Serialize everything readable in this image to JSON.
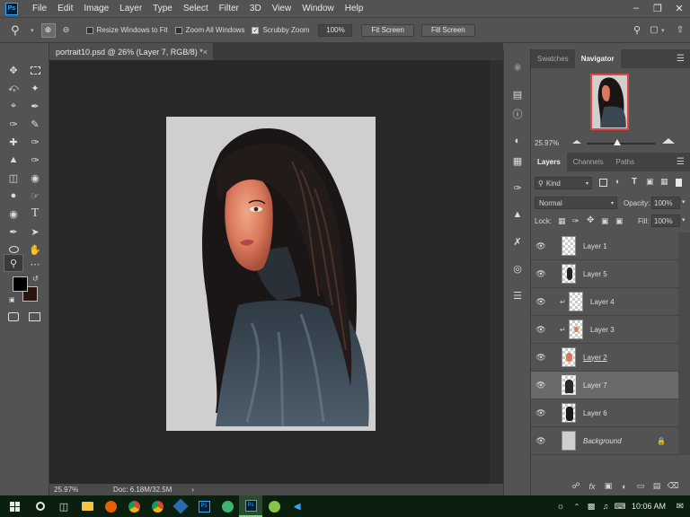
{
  "menubar": {
    "logo": "Ps",
    "items": [
      "File",
      "Edit",
      "Image",
      "Layer",
      "Type",
      "Select",
      "Filter",
      "3D",
      "View",
      "Window",
      "Help"
    ],
    "window_controls": [
      "–",
      "❐",
      "✕"
    ]
  },
  "options_bar": {
    "resize_windows": {
      "label": "Resize Windows to Fit",
      "checked": false
    },
    "zoom_all": {
      "label": "Zoom All Windows",
      "checked": false
    },
    "scrubby": {
      "label": "Scrubby Zoom",
      "checked": true
    },
    "zoom_value": "100%",
    "fit_screen": "Fit Screen",
    "fill_screen": "Fill Screen"
  },
  "document": {
    "tab_title": "portrait10.psd @ 26% (Layer 7, RGB/8) *",
    "close": "×"
  },
  "status": {
    "zoom": "25.97%",
    "doc": "Doc: 6.18M/32.5M",
    "arrow": "›"
  },
  "navigator": {
    "tabs": [
      "Swatches",
      "Navigator"
    ],
    "active_tab": "Navigator",
    "zoom": "25.97%",
    "slider_fraction": 0.45
  },
  "layers_panel": {
    "tabs": [
      "Layers",
      "Channels",
      "Paths"
    ],
    "active_tab": "Layers",
    "filter": "Kind",
    "blend_mode": "Normal",
    "opacity_label": "Opacity:",
    "opacity": "100%",
    "lock_label": "Lock:",
    "fill_label": "Fill:",
    "fill": "100%",
    "layers": [
      {
        "name": "Layer 1",
        "clipped": false,
        "selected": false,
        "thumb": "transparent"
      },
      {
        "name": "Layer 5",
        "clipped": false,
        "selected": false,
        "thumb": "hair"
      },
      {
        "name": "Layer 4",
        "clipped": true,
        "selected": false,
        "thumb": "transparent"
      },
      {
        "name": "Layer 3",
        "clipped": true,
        "selected": false,
        "thumb": "skin-dot"
      },
      {
        "name": "Layer 2",
        "clipped": false,
        "selected": false,
        "thumb": "skin"
      },
      {
        "name": "Layer 7",
        "clipped": false,
        "selected": true,
        "thumb": "figure"
      },
      {
        "name": "Layer 6",
        "clipped": false,
        "selected": false,
        "thumb": "figure-dark"
      },
      {
        "name": "Background",
        "clipped": false,
        "selected": false,
        "thumb": "gray",
        "locked": true
      }
    ],
    "footer_icons": [
      "link-icon",
      "fx-icon",
      "mask-icon",
      "adjustment-icon",
      "group-icon",
      "new-layer-icon",
      "trash-icon"
    ]
  },
  "taskbar": {
    "time": "10:06 AM",
    "apps": [
      "windows-start-icon",
      "cortana-icon",
      "task-view-icon",
      "file-explorer-icon",
      "firefox-icon",
      "chrome-icon",
      "chrome-icon-2",
      "app-icon",
      "photoshop-icon",
      "edge-icon",
      "photoshop-active-icon",
      "app-icon-2",
      "vscode-icon"
    ]
  }
}
